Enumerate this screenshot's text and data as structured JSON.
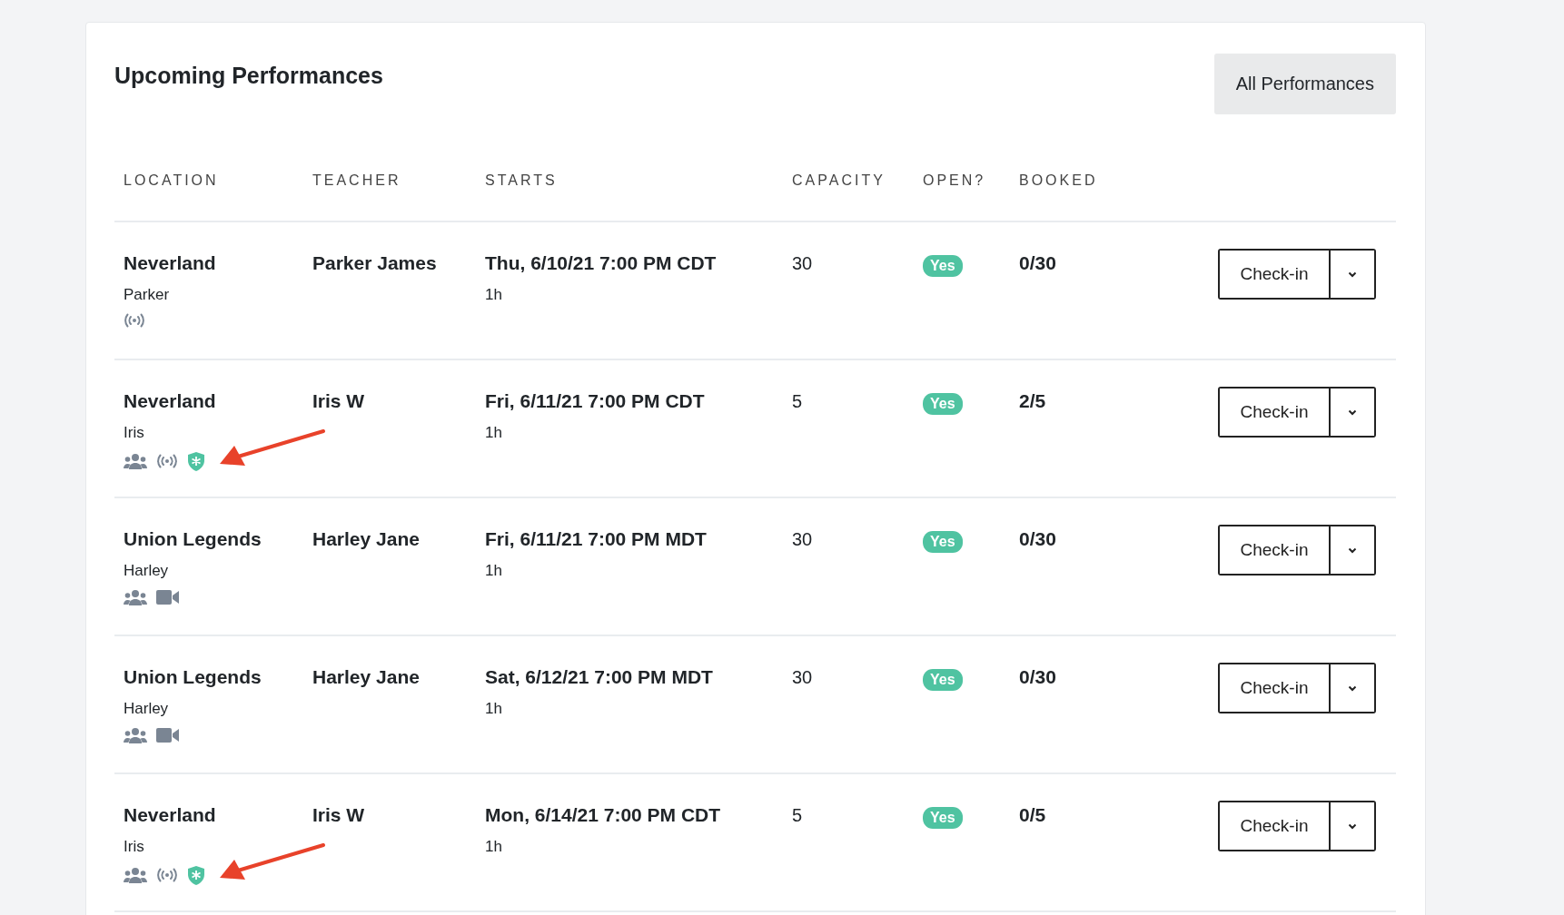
{
  "title": "Upcoming Performances",
  "all_button": "All Performances",
  "columns": [
    "LOCATION",
    "TEACHER",
    "STARTS",
    "CAPACITY",
    "OPEN?",
    "BOOKED"
  ],
  "rows": [
    {
      "location": "Neverland",
      "sublocation": "Parker",
      "features": [
        {
          "kind": "broadcast"
        }
      ],
      "annotated": false,
      "teacher": "Parker James",
      "starts": "Thu, 6/10/21 7:00 PM CDT",
      "duration": "1h",
      "capacity": "30",
      "open": "Yes",
      "booked": "0/30",
      "action": "Check-in"
    },
    {
      "location": "Neverland",
      "sublocation": "Iris",
      "features": [
        {
          "kind": "group"
        },
        {
          "kind": "broadcast"
        },
        {
          "kind": "shield"
        }
      ],
      "annotated": true,
      "teacher": "Iris W",
      "starts": "Fri, 6/11/21 7:00 PM CDT",
      "duration": "1h",
      "capacity": "5",
      "open": "Yes",
      "booked": "2/5",
      "action": "Check-in"
    },
    {
      "location": "Union Legends",
      "sublocation": "Harley",
      "features": [
        {
          "kind": "group"
        },
        {
          "kind": "video"
        }
      ],
      "annotated": false,
      "teacher": "Harley Jane",
      "starts": "Fri, 6/11/21 7:00 PM MDT",
      "duration": "1h",
      "capacity": "30",
      "open": "Yes",
      "booked": "0/30",
      "action": "Check-in"
    },
    {
      "location": "Union Legends",
      "sublocation": "Harley",
      "features": [
        {
          "kind": "group"
        },
        {
          "kind": "video"
        }
      ],
      "annotated": false,
      "teacher": "Harley Jane",
      "starts": "Sat, 6/12/21 7:00 PM MDT",
      "duration": "1h",
      "capacity": "30",
      "open": "Yes",
      "booked": "0/30",
      "action": "Check-in"
    },
    {
      "location": "Neverland",
      "sublocation": "Iris",
      "features": [
        {
          "kind": "group"
        },
        {
          "kind": "broadcast"
        },
        {
          "kind": "shield"
        }
      ],
      "annotated": true,
      "teacher": "Iris W",
      "starts": "Mon, 6/14/21 7:00 PM CDT",
      "duration": "1h",
      "capacity": "5",
      "open": "Yes",
      "booked": "0/5",
      "action": "Check-in"
    }
  ]
}
